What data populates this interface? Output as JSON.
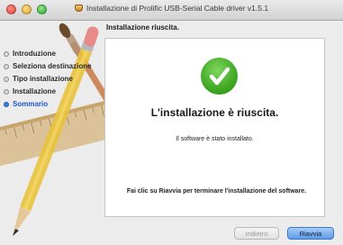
{
  "window": {
    "title": "Installazione di Prolific USB-Serial Cable driver v1.5.1",
    "section_title": "Installazione riuscita."
  },
  "sidebar": {
    "steps": [
      {
        "label": "Introduzione"
      },
      {
        "label": "Seleziona destinazione"
      },
      {
        "label": "Tipo installazione"
      },
      {
        "label": "Installazione"
      },
      {
        "label": "Sommario"
      }
    ]
  },
  "main": {
    "headline": "L'installazione è riuscita.",
    "message": "Il software è stato installato.",
    "footer_note": "Fai clic su Riavvia per terminare l'installazione del software."
  },
  "buttons": {
    "back_label": "Indietro",
    "restart_label": "Riavvia"
  },
  "colors": {
    "accent": "#3a7de0",
    "success": "#3fa823"
  },
  "icons": [
    "close-icon",
    "minimize-icon",
    "zoom-icon",
    "package-icon",
    "checkmark-icon"
  ]
}
